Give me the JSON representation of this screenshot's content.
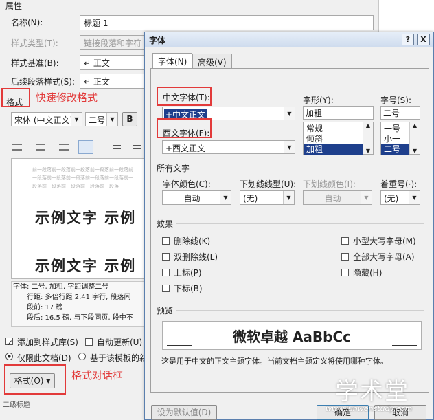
{
  "style_dialog": {
    "section_label": "属性",
    "name_label": "名称(N):",
    "name_value": "标题 1",
    "style_type_label": "样式类型(T):",
    "style_type_value": "链接段落和字符",
    "based_on_label": "样式基准(B):",
    "based_on_value": "↵ 正文",
    "following_label": "后续段落样式(S):",
    "following_value": "↵ 正文",
    "format_label": "格式",
    "font_combo": "宋体 (中文正文)",
    "size_combo": "二号",
    "bold_button": "B",
    "preview_prev_para": "前一段落前一段落前一段落前一段落前一段落前一段落前一段落前一段落前一段落前一段落前一段落前一段落前一段落前一段落前一段落",
    "preview_sample_1": "示例文字  示例",
    "preview_sample_2": "示例文字  示例",
    "desc_lines": [
      "字体: 二号, 加粗, 字距调整二号",
      "行距: 多倍行距 2.41 字行, 段落间",
      "段前: 17 磅",
      "段后: 16.5 磅, 与下段同页, 段中不"
    ],
    "add_to_gallery": "添加到样式库(S)",
    "auto_update": "自动更新(U)",
    "only_this_doc": "仅限此文档(D)",
    "template_based": "基于该模板的新",
    "format_button": "格式(O) ▾",
    "bottom_text": "二级标题"
  },
  "annotations": {
    "quick_format": "快速修改格式",
    "format_dialog": "格式对话框"
  },
  "font_dialog": {
    "title": "字体",
    "help": "?",
    "close": "X",
    "tabs": [
      "字体(N)",
      "高级(V)"
    ],
    "cn_font_label": "中文字体(T):",
    "cn_font_value": "+中文正文",
    "style_label": "字形(Y):",
    "style_value": "加粗",
    "style_options": [
      "常规",
      "倾斜",
      "加粗"
    ],
    "size_label": "字号(S):",
    "size_value": "二号",
    "size_options": [
      "一号",
      "小一",
      "二号"
    ],
    "west_font_label": "西文字体(F):",
    "west_font_value": "+西文正文",
    "all_text_header": "所有文字",
    "font_color_label": "字体颜色(C):",
    "font_color_value": "自动",
    "underline_style_label": "下划线线型(U):",
    "underline_style_value": "(无)",
    "underline_color_label": "下划线颜色(I):",
    "underline_color_value": "自动",
    "emphasis_label": "着重号(·):",
    "emphasis_value": "(无)",
    "effects_header": "效果",
    "effects_left": [
      "删除线(K)",
      "双删除线(L)",
      "上标(P)",
      "下标(B)"
    ],
    "effects_right": [
      "小型大写字母(M)",
      "全部大写字母(A)",
      "隐藏(H)"
    ],
    "preview_header": "预览",
    "preview_text": "微软卓越  AaBbCc",
    "preview_note": "这是用于中文的正文主题字体。当前文档主题定义将使用哪种字体。",
    "set_default": "设为默认值(D)",
    "ok": "确定",
    "cancel": "取消"
  },
  "watermark": {
    "brand": "学术堂",
    "url": "www.lunwenstudy.com"
  },
  "colors": {
    "annotation_red": "#e23a3a",
    "selection_blue": "#1e3f8c"
  }
}
